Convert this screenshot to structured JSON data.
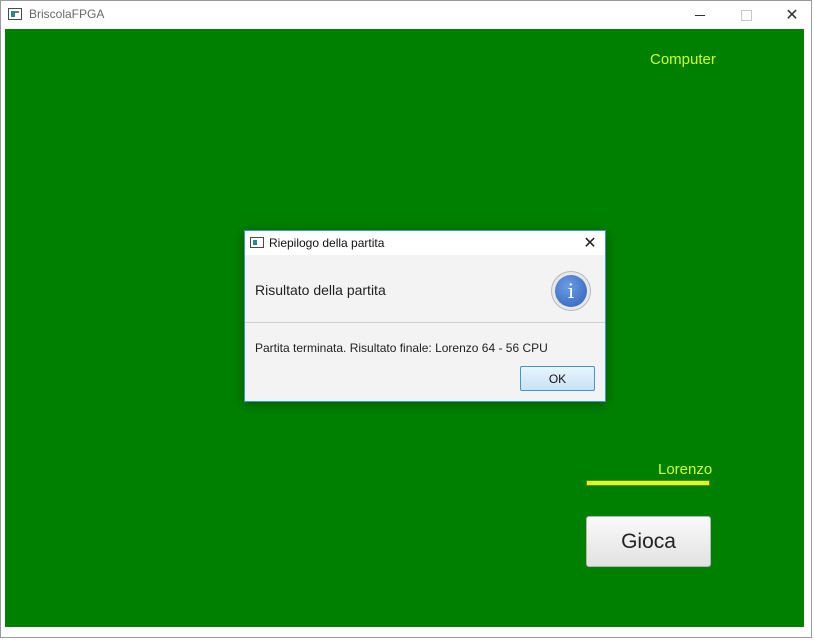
{
  "window": {
    "title": "BriscolaFPGA",
    "controls": {
      "minimize": "minimize",
      "maximize": "maximize",
      "close": "✕"
    }
  },
  "board": {
    "opponent_label": "Computer",
    "player_label": "Lorenzo",
    "play_button": "Gioca",
    "colors": {
      "background": "#008000",
      "label": "#d0ff2a"
    }
  },
  "dialog": {
    "title": "Riepilogo della partita",
    "header": "Risultato della partita",
    "icon": "info-icon",
    "icon_glyph": "i",
    "content": "Partita terminata. Risultato finale: Lorenzo 64 - 56 CPU",
    "ok_button": "OK",
    "close_glyph": "✕"
  }
}
